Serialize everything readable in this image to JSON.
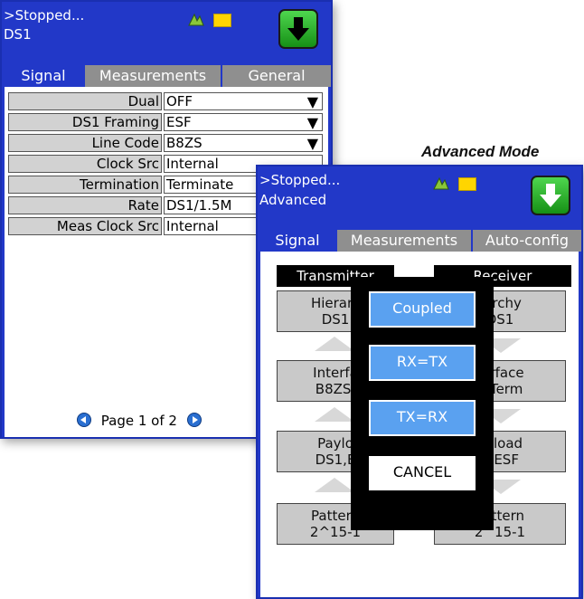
{
  "caption": "Advanced Mode",
  "screen1": {
    "status_line1": ">Stopped...",
    "status_line2": "DS1",
    "tabs": [
      "Signal",
      "Measurements",
      "General"
    ],
    "rows": [
      {
        "label": "Dual",
        "value": "OFF",
        "dropdown": true
      },
      {
        "label": "DS1 Framing",
        "value": "ESF",
        "dropdown": true
      },
      {
        "label": "Line Code",
        "value": "B8ZS",
        "dropdown": true
      },
      {
        "label": "Clock Src",
        "value": "Internal",
        "dropdown": false
      },
      {
        "label": "Termination",
        "value": "Terminate",
        "dropdown": false
      },
      {
        "label": "Rate",
        "value": "DS1/1.5M",
        "dropdown": false
      },
      {
        "label": "Meas Clock Src",
        "value": "Internal",
        "dropdown": false
      }
    ],
    "pager": "Page 1 of 2"
  },
  "screen2": {
    "status_line1": ">Stopped...",
    "status_line2": "Advanced",
    "tabs": [
      "Signal",
      "Measurements",
      "Auto-config"
    ],
    "transmitter_label": "Transmitter",
    "receiver_label": "Receiver",
    "tx_boxes": [
      {
        "line1": "Hierarc",
        "line2": "DS1"
      },
      {
        "line1": "Interfa",
        "line2": "B8ZS,"
      },
      {
        "line1": "Paylo",
        "line2": "DS1,E"
      },
      {
        "line1": "Pattern",
        "line2": "2^15-1"
      }
    ],
    "rx_boxes": [
      {
        "line1": "rarchy",
        "line2": "DS1"
      },
      {
        "line1": "terface",
        "line2": "S,Term"
      },
      {
        "line1": "ayload",
        "line2": "1,ESF"
      },
      {
        "line1": "Pattern",
        "line2": "2^15-1"
      }
    ],
    "popup": {
      "coupled": "Coupled",
      "rx_tx": "RX=TX",
      "tx_rx": "TX=RX",
      "cancel": "CANCEL"
    }
  },
  "colors": {
    "header_blue": "#2238c8",
    "tab_gray": "#8f8f8f",
    "run_green": "#2bb52b",
    "popup_button": "#5aa1f0"
  },
  "icons": [
    "network-icon",
    "folder-icon",
    "down-arrow-icon",
    "dropdown-arrow-icon",
    "page-prev-icon",
    "page-next-icon"
  ]
}
